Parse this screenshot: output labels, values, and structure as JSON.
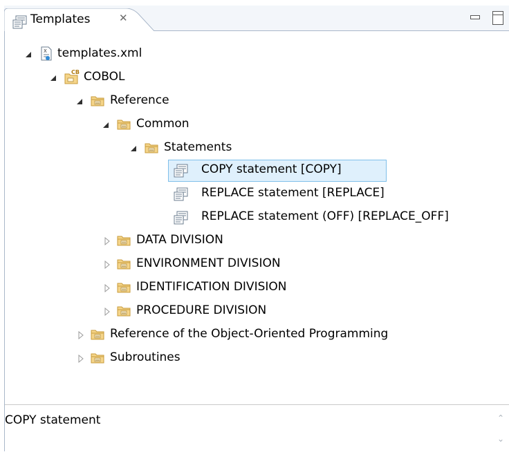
{
  "view": {
    "tab_title": "Templates",
    "tab_close_glyph": "✕",
    "minimize_icon": "minimize-icon",
    "maximize_icon": "maximize-icon"
  },
  "tree": {
    "root": {
      "label": "templates.xml",
      "icon": "xml-file-icon",
      "expanded": true
    },
    "cobol": {
      "label": "COBOL",
      "icon": "cobol-icon",
      "expanded": true
    },
    "reference": {
      "label": "Reference",
      "icon": "folder-icon",
      "expanded": true
    },
    "common": {
      "label": "Common",
      "icon": "folder-icon",
      "expanded": true
    },
    "statements": {
      "label": "Statements",
      "icon": "folder-icon",
      "expanded": true
    },
    "templates": [
      {
        "label": "COPY statement  [COPY]",
        "icon": "template-icon",
        "selected": true
      },
      {
        "label": "REPLACE statement  [REPLACE]",
        "icon": "template-icon",
        "selected": false
      },
      {
        "label": "REPLACE statement (OFF)  [REPLACE_OFF]",
        "icon": "template-icon",
        "selected": false
      }
    ],
    "divisions": [
      {
        "label": "DATA DIVISION",
        "icon": "folder-icon",
        "expanded": false
      },
      {
        "label": "ENVIRONMENT DIVISION",
        "icon": "folder-icon",
        "expanded": false
      },
      {
        "label": "IDENTIFICATION DIVISION",
        "icon": "folder-icon",
        "expanded": false
      },
      {
        "label": "PROCEDURE DIVISION",
        "icon": "folder-icon",
        "expanded": false
      }
    ],
    "top_folders": [
      {
        "label": "Reference of the Object-Oriented Programming",
        "icon": "folder-icon",
        "expanded": false
      },
      {
        "label": "Subroutines",
        "icon": "folder-icon",
        "expanded": false
      }
    ]
  },
  "description": {
    "text": "COPY statement"
  },
  "colors": {
    "selection_bg": "#dff0fc",
    "selection_border": "#7fbfea",
    "folder_fill": "#f5d58a",
    "folder_stroke": "#c79a3a"
  }
}
